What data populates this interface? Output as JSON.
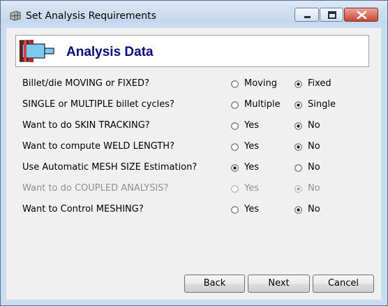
{
  "window": {
    "title": "Set Analysis Requirements"
  },
  "banner": {
    "title": "Analysis Data"
  },
  "questions": [
    {
      "label": "Billet/die MOVING or FIXED?",
      "options": [
        "Moving",
        "Fixed"
      ],
      "selected": 1,
      "enabled": true
    },
    {
      "label": "SINGLE or MULTIPLE billet cycles?",
      "options": [
        "Multiple",
        "Single"
      ],
      "selected": 1,
      "enabled": true
    },
    {
      "label": "Want to do SKIN TRACKING?",
      "options": [
        "Yes",
        "No"
      ],
      "selected": 1,
      "enabled": true
    },
    {
      "label": "Want to compute WELD LENGTH?",
      "options": [
        "Yes",
        "No"
      ],
      "selected": 1,
      "enabled": true
    },
    {
      "label": "Use Automatic MESH SIZE Estimation?",
      "options": [
        "Yes",
        "No"
      ],
      "selected": 0,
      "enabled": true
    },
    {
      "label": "Want to do COUPLED ANALYSIS?",
      "options": [
        "Yes",
        "No"
      ],
      "selected": 1,
      "enabled": false
    },
    {
      "label": "Want to Control MESHING?",
      "options": [
        "Yes",
        "No"
      ],
      "selected": 1,
      "enabled": true
    }
  ],
  "buttons": {
    "back": "Back",
    "next": "Next",
    "cancel": "Cancel"
  }
}
